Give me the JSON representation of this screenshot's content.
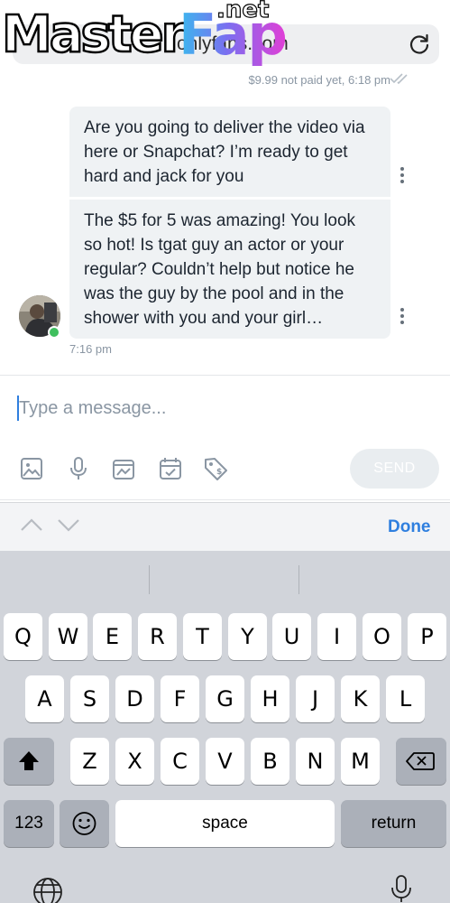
{
  "browser": {
    "url_display": "onlyfans.com",
    "watermark": {
      "part1": "Master",
      "part2": "Fap",
      "part3": ".net"
    }
  },
  "chat": {
    "previous_status": "$9.99 not paid yet, 6:18 pm",
    "messages": [
      {
        "text": "Are you going to deliver the video via here or Snapchat? I’m ready to get hard and jack for you"
      },
      {
        "text": "The $5 for 5 was amazing! You look so hot! Is tgat guy an actor or your regular? Couldn’t help but notice he was the guy by the pool and in the shower with you and your girl…"
      }
    ],
    "time": "7:16 pm"
  },
  "composer": {
    "placeholder": "Type a message...",
    "value": "",
    "send_label": "SEND",
    "tools": [
      "image-icon",
      "microphone-icon",
      "vault-icon",
      "schedule-icon",
      "price-tag-icon"
    ]
  },
  "accessory": {
    "done_label": "Done"
  },
  "keyboard": {
    "row1": [
      "Q",
      "W",
      "E",
      "R",
      "T",
      "Y",
      "U",
      "I",
      "O",
      "P"
    ],
    "row2": [
      "A",
      "S",
      "D",
      "F",
      "G",
      "H",
      "J",
      "K",
      "L"
    ],
    "row3": [
      "Z",
      "X",
      "C",
      "V",
      "B",
      "N",
      "M"
    ],
    "numbers_label": "123",
    "space_label": "space",
    "return_label": "return"
  },
  "colors": {
    "accent": "#2f7fdf",
    "bubble": "#eff2f4",
    "online": "#3fbf5e",
    "muted": "#8a96a3"
  }
}
